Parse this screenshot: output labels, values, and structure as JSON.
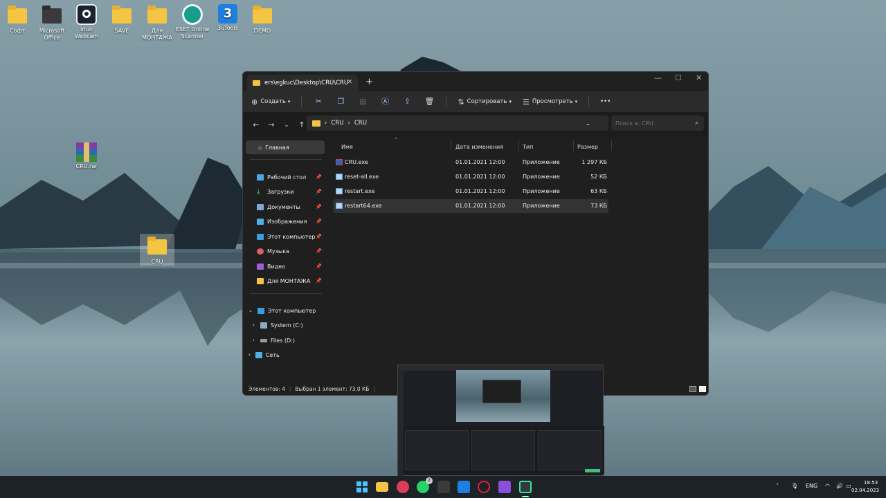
{
  "desktop": {
    "icons": [
      {
        "label": "Софт"
      },
      {
        "label": "Microsoft Office"
      },
      {
        "label": "Iriun Webcam"
      },
      {
        "label": "SAVE"
      },
      {
        "label": "Для МОНТАЖА"
      },
      {
        "label": "ESET Online Scanner"
      },
      {
        "label": "3uTools"
      },
      {
        "label": "DEMO"
      },
      {
        "label": "CRU.rar"
      },
      {
        "label": "CRU"
      }
    ]
  },
  "explorer": {
    "tab_title": "ers\\egkuc\\Desktop\\CRU\\CRU",
    "toolbar": {
      "create": "Создать",
      "sort": "Сортировать",
      "view": "Просмотреть"
    },
    "address": {
      "segments": [
        "CRU",
        "CRU"
      ],
      "search_placeholder": "Поиск в: CRU"
    },
    "sidebar": {
      "home": "Главная",
      "quick": [
        "Рабочий стол",
        "Загрузки",
        "Документы",
        "Изображения",
        "Этот компьютер",
        "Музыка",
        "Видео",
        "Для МОНТАЖА"
      ],
      "tree": [
        "Этот компьютер",
        "System (C:)",
        "Files (D:)",
        "Сеть"
      ]
    },
    "columns": {
      "name": "Имя",
      "date": "Дата изменения",
      "type": "Тип",
      "size": "Размер"
    },
    "files": [
      {
        "name": "CRU.exe",
        "date": "01.01.2021 12:00",
        "type": "Приложение",
        "size": "1 297 КБ"
      },
      {
        "name": "reset-all.exe",
        "date": "01.01.2021 12:00",
        "type": "Приложение",
        "size": "52 КБ"
      },
      {
        "name": "restart.exe",
        "date": "01.01.2021 12:00",
        "type": "Приложение",
        "size": "63 КБ"
      },
      {
        "name": "restart64.exe",
        "date": "01.01.2021 12:00",
        "type": "Приложение",
        "size": "73 КБ"
      }
    ],
    "status": {
      "count": "Элементов: 4",
      "selected": "Выбран 1 элемент: 73,0 КБ"
    }
  },
  "taskbar": {
    "lang": "ENG",
    "time": "18:53",
    "date": "02.04.2023",
    "whatsapp_badge": "2"
  },
  "colors": {
    "folder": "#f4c542",
    "window_bg": "#1f1f1f",
    "taskbar_bg": "#1c2226"
  }
}
